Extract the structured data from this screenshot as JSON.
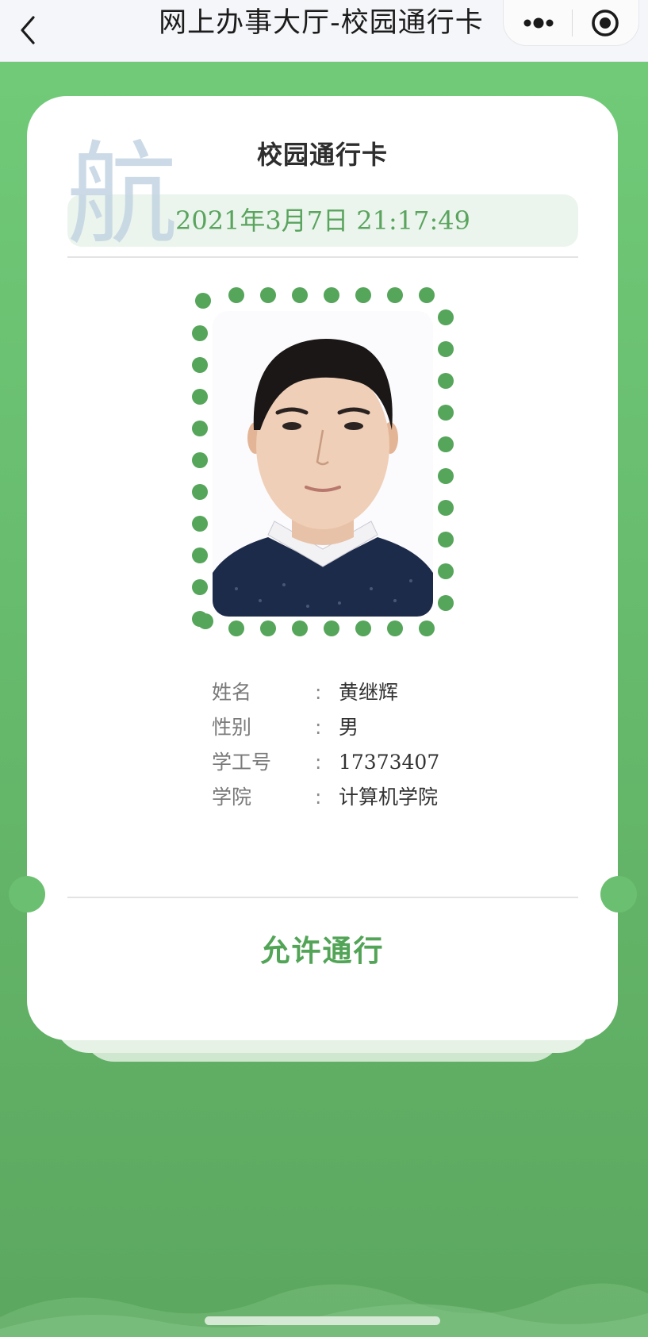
{
  "navbar": {
    "title": "网上办事大厅-校园通行卡",
    "back_icon": "chevron-left-icon",
    "menu_icon": "more-dots-icon",
    "close_icon": "target-circle-icon"
  },
  "card": {
    "watermark": "航",
    "title": "校园通行卡",
    "datetime": "2021年3月7日 21:17:49",
    "photo_alt": "student id photo",
    "info": [
      {
        "label": "姓名",
        "colon": ":",
        "value": "黄继辉"
      },
      {
        "label": "性别",
        "colon": ":",
        "value": "男"
      },
      {
        "label": "学工号",
        "colon": ":",
        "value": "17373407"
      },
      {
        "label": "学院",
        "colon": ":",
        "value": "计算机学院"
      }
    ],
    "status": "允许通行"
  },
  "colors": {
    "accent": "#5aa45e",
    "background_top": "#71cc79",
    "background_bottom": "#5ca760",
    "dot_frame": "#55a55a"
  }
}
